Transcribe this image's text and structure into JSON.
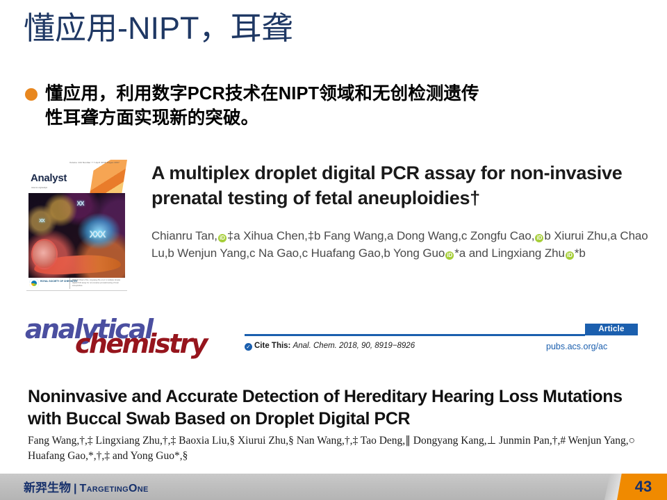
{
  "slide": {
    "title": "懂应用-NIPT，耳聋",
    "bullet": "懂应用，利用数字PCR技术在NIPT领域和无创检测遗传性耳聋方面实现新的突破。"
  },
  "paper1": {
    "cover": {
      "masthead": "Analyst",
      "subhead": "www.rsc.org/analyst",
      "issue_line": "Volume 144  Number 7  7 April 2019  Pages 2097-2388",
      "publisher_text": "ROYAL SOCIETY OF CHEMISTRY",
      "footer_meta": "PAPER\nChianru Tan, Lingxiang Zhu et al.\nA multiplex droplet digital PCR assay for non-invasive\nprenatal testing of fetal aneuploidies"
    },
    "title": "A multiplex droplet digital PCR assay for non-invasive prenatal testing of fetal aneuploidies†",
    "authors_line1": "Chianru Tan,",
    "authors_line1b": "‡a Xihua Chen,‡b Fang Wang,a Dong Wang,c Zongfu Cao,",
    "authors_line1c": "b",
    "authors_line2a": "Xiurui Zhu,a Chao Lu,b Wenjun Yang,c Na Gao,c Huafang Gao,b Yong Guo",
    "authors_line2b": "*a and",
    "authors_line3a": "Lingxiang Zhu",
    "authors_line3b": "*b",
    "orcid_glyph": "iD"
  },
  "paper2": {
    "journal_word1": "analytical",
    "journal_word2": "chemistry",
    "badge": "Article",
    "cite_label": "Cite This:",
    "cite_reference": "Anal. Chem. 2018, 90, 8919−8926",
    "url": "pubs.acs.org/ac",
    "title": "Noninvasive and Accurate Detection of Hereditary Hearing Loss Mutations with Buccal Swab Based on Droplet Digital PCR",
    "authors": "Fang Wang,†,‡ Lingxiang Zhu,†,‡ Baoxia Liu,§ Xiurui Zhu,§ Nan Wang,†,‡ Tao Deng,∥ Dongyang Kang,⊥ Junmin Pan,†,# Wenjun Yang,○ Huafang Gao,*,†,‡ and Yong Guo*,§",
    "check_glyph": "✓"
  },
  "footer": {
    "logo_cn": "新羿生物",
    "logo_separator": "|",
    "logo_en": "TargetingOne",
    "page_number": "43"
  },
  "colors": {
    "title_blue": "#1F3864",
    "bullet_orange": "#E8871F",
    "acs_blue": "#1B5FAE",
    "journal_purple": "#4B4FA0",
    "journal_red": "#96151D",
    "orcid_green": "#A6CE39",
    "footer_gray": "#BDBDBD",
    "page_badge_orange": "#F08A00",
    "page_number_navy": "#16306B"
  }
}
